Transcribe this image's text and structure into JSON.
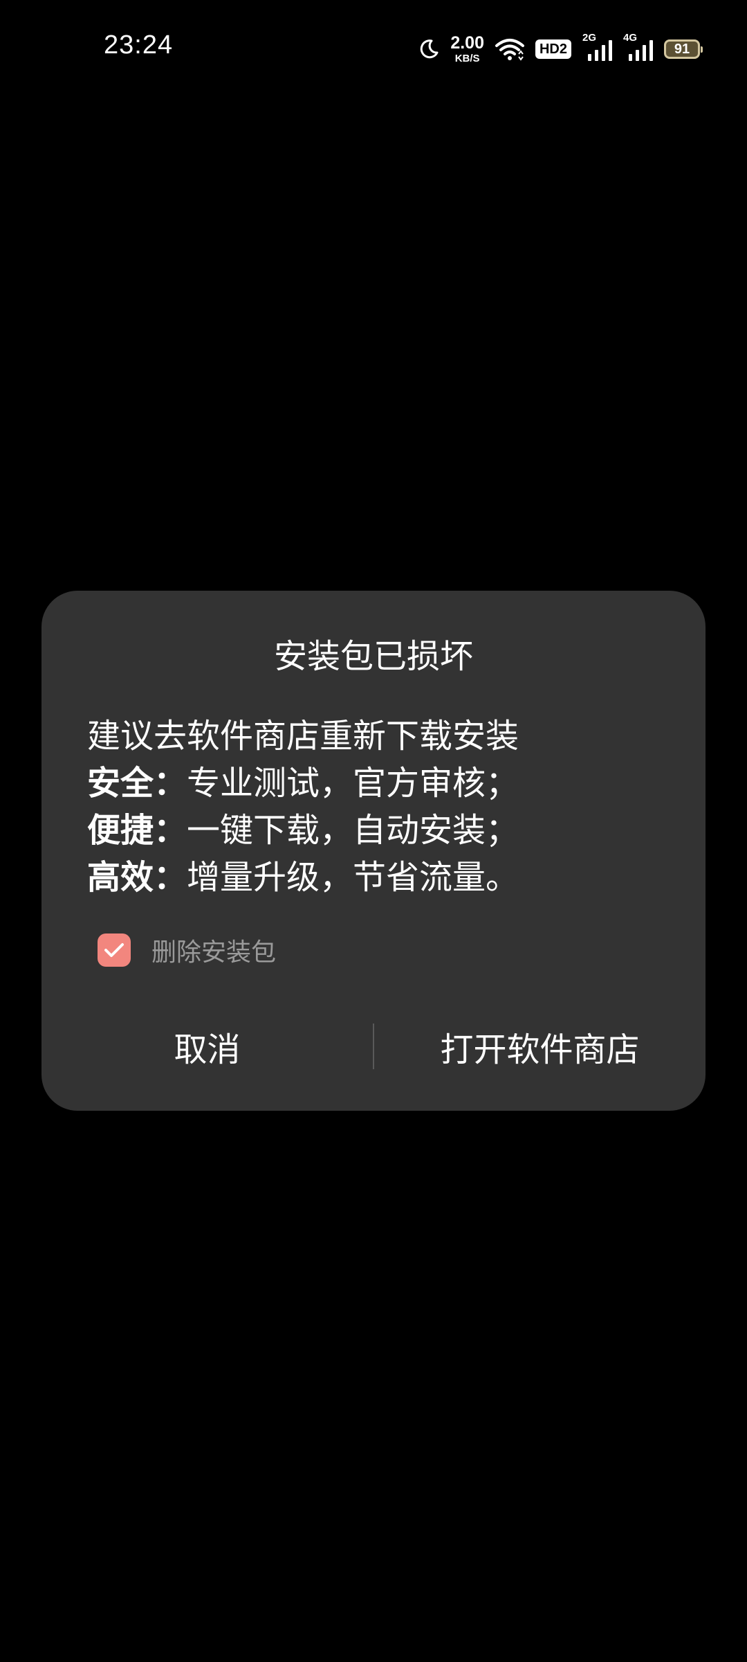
{
  "status_bar": {
    "time": "23:24",
    "net_speed_value": "2.00",
    "net_speed_unit": "KB/S",
    "hd_badge": "HD2",
    "signal_1_label": "2G",
    "signal_2_label": "4G",
    "battery_level": "91",
    "icons": [
      "moon-icon",
      "wifi-icon",
      "signal-icon",
      "battery-icon"
    ]
  },
  "dialog": {
    "title": "安装包已损坏",
    "intro": "建议去软件商店重新下载安装",
    "points": [
      {
        "label": "安全",
        "separator": "：",
        "text": "专业测试，官方审核；"
      },
      {
        "label": "便捷",
        "separator": "：",
        "text": "一键下载，自动安装；"
      },
      {
        "label": "高效",
        "separator": "：",
        "text": "增量升级，节省流量。"
      }
    ],
    "checkbox_label": "删除安装包",
    "checkbox_checked": true,
    "cancel_label": "取消",
    "open_store_label": "打开软件商店",
    "colors": {
      "background": "#333333",
      "checkbox": "#f2867e"
    }
  }
}
